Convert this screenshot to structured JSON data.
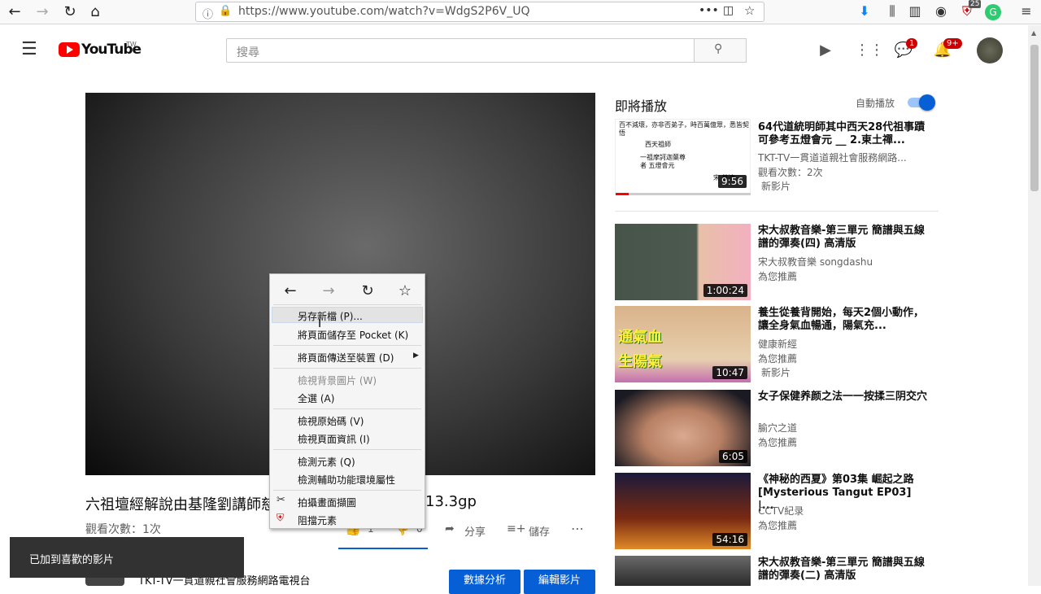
{
  "browser": {
    "url": "https://www.youtube.com/watch?v=WdgS2P6V_UQ",
    "download_badge": "25"
  },
  "header": {
    "logo_text": "YouTube",
    "logo_region": "TW",
    "search_placeholder": "搜尋",
    "messages_badge": "1",
    "notifications_badge": "9+"
  },
  "video": {
    "title_left": "六祖壇經解說由基隆劉講師慈",
    "title_right": "13.3gp",
    "views": "觀看次數：1次",
    "like_count": "1",
    "dislike_count": "0",
    "share_label": "分享",
    "save_label": "儲存",
    "channel_name": "TKT-TV一貫道親社會服務網路電視台",
    "analytics_button": "數據分析",
    "edit_button": "編輯影片"
  },
  "context_menu": {
    "items": [
      "另存新檔 (P)...",
      "將頁面儲存至 Pocket (K)",
      "將頁面傳送至裝置 (D)",
      "檢視背景圖片 (W)",
      "全選 (A)",
      "檢視原始碼 (V)",
      "檢視頁面資訊 (I)",
      "檢測元素 (Q)",
      "檢測輔助功能環境屬性",
      "拍攝畫面擷圖",
      "阻擋元素"
    ]
  },
  "upnext": {
    "heading": "即將播放",
    "autoplay_label": "自動播放",
    "autoplay_on": true
  },
  "related": [
    {
      "title": "64代道統明師其中西天28代祖事蹟可參考五燈會元 __ 2.東土禪...",
      "channel": "TKT-TV一貫道道親社會服務網路...",
      "views": "觀看次數：2次",
      "badge": "新影片",
      "duration": "9:56"
    },
    {
      "title": "宋大叔教音樂-第三單元 簡譜與五線譜的彈奏(四) 高清版",
      "channel": "宋大叔教音樂 songdashu",
      "views": "為您推薦",
      "badge": "",
      "duration": "1:00:24"
    },
    {
      "title": "養生從養背開始，每天2個小動作，讓全身氣血暢通，陽氣充...",
      "channel": "健康新經",
      "views": "為您推薦",
      "badge": "新影片",
      "duration": "10:47"
    },
    {
      "title": "女子保健养颜之法一一按揉三阴交穴",
      "channel": "腧穴之道",
      "views": "為您推薦",
      "badge": "",
      "duration": "6:05"
    },
    {
      "title": "《神秘的西夏》第03集 崛起之路 [Mysterious Tangut EP03] |...",
      "channel": "CCTV紀录",
      "views": "為您推薦",
      "badge": "",
      "duration": "54:16"
    },
    {
      "title": "宋大叔教音樂-第三單元 簡譜與五線譜的彈奏(二) 高清版",
      "channel": "",
      "views": "",
      "badge": "",
      "duration": ""
    }
  ],
  "toast": {
    "message": "已加到喜歡的影片"
  },
  "thumb_texts": {
    "t1_heading": "百不減壞，亦非否弟子，時百萬億眾，悉皆契悟",
    "t1_sub1": "西天祖師",
    "t1_sub2": "一祖摩訶迦葉尊者 五燈會元",
    "t1_author": "宋 普濟",
    "t3_line1": "通氣血",
    "t3_line2": "生陽氣"
  }
}
